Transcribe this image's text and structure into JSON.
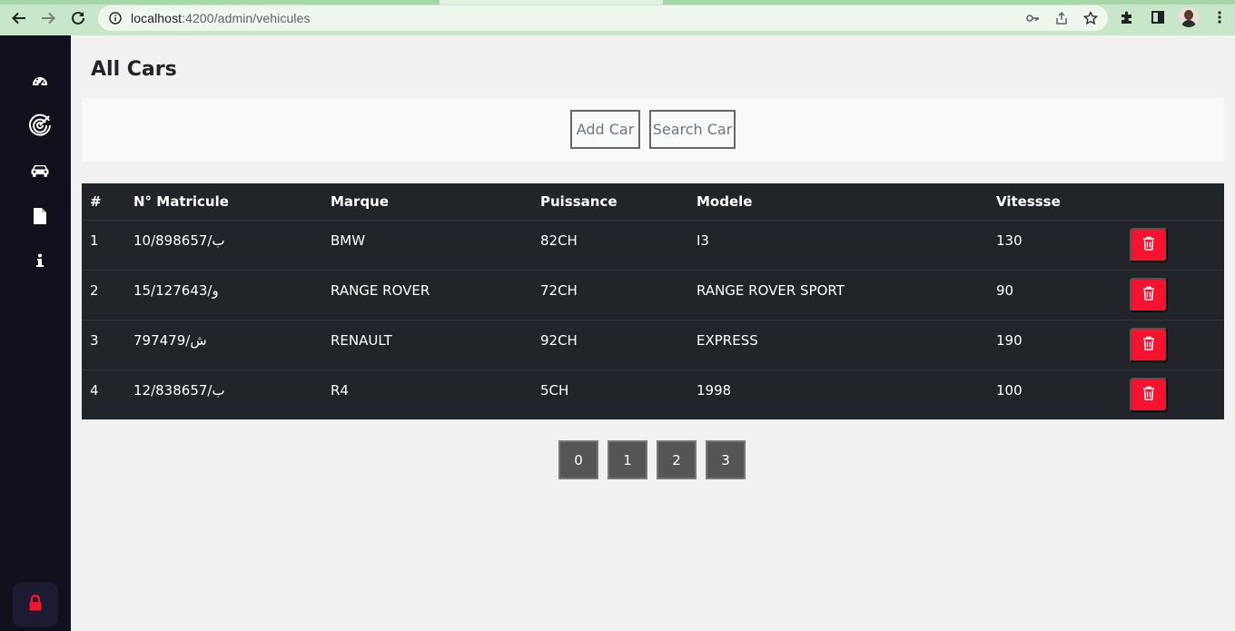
{
  "browser": {
    "url_host": "localhost",
    "url_rest": ":4200/admin/vehicules"
  },
  "sidebar": {
    "items": [
      {
        "icon": "dashboard-gauge-icon"
      },
      {
        "icon": "target-icon"
      },
      {
        "icon": "car-icon"
      },
      {
        "icon": "file-icon"
      },
      {
        "icon": "info-icon"
      }
    ],
    "logout_icon": "lock-icon"
  },
  "page": {
    "title": "All Cars"
  },
  "toolbar": {
    "add_label": "Add Car",
    "search_label": "Search Car"
  },
  "table": {
    "headers": [
      "#",
      "N° Matricule",
      "Marque",
      "Puissance",
      "Modele",
      "Vitessse"
    ],
    "rows": [
      {
        "num": "1",
        "matricule": "10/898657/ب",
        "marque": "BMW",
        "puissance": "82CH",
        "modele": "I3",
        "vitesse": "130"
      },
      {
        "num": "2",
        "matricule": "15/127643/و",
        "marque": "RANGE ROVER",
        "puissance": "72CH",
        "modele": "RANGE ROVER SPORT",
        "vitesse": "90"
      },
      {
        "num": "3",
        "matricule": "797479/ش",
        "marque": "RENAULT",
        "puissance": "92CH",
        "modele": "EXPRESS",
        "vitesse": "190"
      },
      {
        "num": "4",
        "matricule": "12/838657/ب",
        "marque": "R4",
        "puissance": "5CH",
        "modele": "1998",
        "vitesse": "100"
      }
    ]
  },
  "pagination": {
    "pages": [
      "0",
      "1",
      "2",
      "3"
    ]
  },
  "colors": {
    "sidebar_bg": "#11101d",
    "table_bg": "#212529",
    "delete_red": "#f5132f"
  }
}
